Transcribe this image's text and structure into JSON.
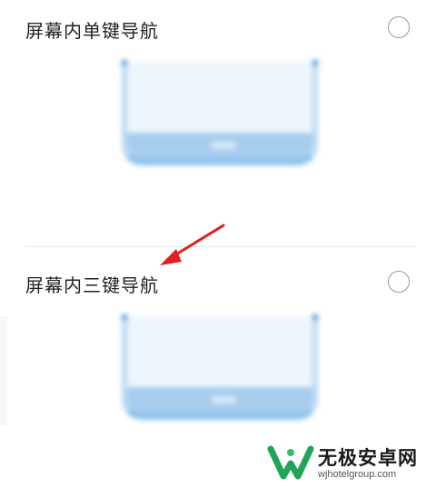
{
  "options": [
    {
      "label": "屏幕内单键导航",
      "selected": false,
      "preview": "single-key-nav-preview"
    },
    {
      "label": "屏幕内三键导航",
      "selected": false,
      "preview": "three-key-nav-preview"
    }
  ],
  "watermark": {
    "title": "无极安卓网",
    "url": "wjhotelgroup.com"
  },
  "colors": {
    "arrow": "#e0201c",
    "preview_blue": "#8ec2ea",
    "logo_green": "#22a35a"
  }
}
